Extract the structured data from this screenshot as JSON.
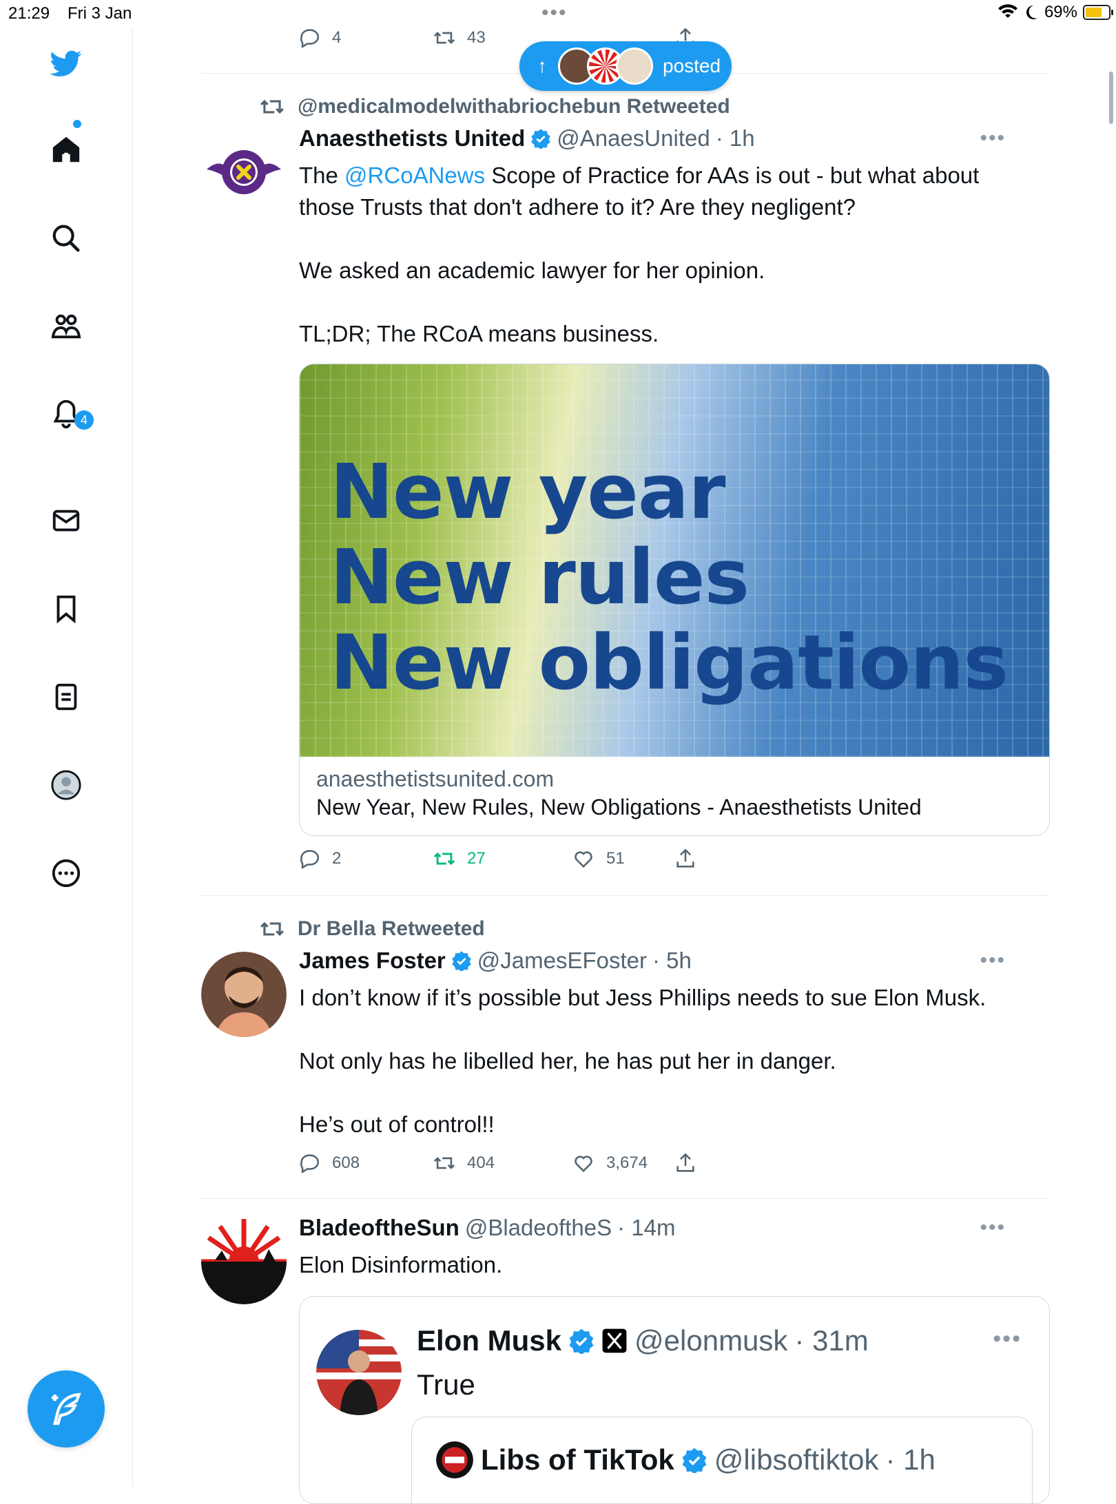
{
  "status_bar": {
    "time": "21:29",
    "date": "Fri 3 Jan",
    "battery": "69%"
  },
  "sidebar": {
    "notifications_badge": "4",
    "items": [
      "twitter-logo",
      "home",
      "search",
      "communities",
      "notifications",
      "messages",
      "bookmarks",
      "lists",
      "profile",
      "more"
    ]
  },
  "posted_pill": {
    "label": "posted"
  },
  "tweet_top_partial": {
    "replies": "4",
    "retweets": "43",
    "likes": "51"
  },
  "tweet1": {
    "retweeted_by": "@medicalmodelwithabriochebun Retweeted",
    "name": "Anaesthetists United",
    "handle": "@AnaesUnited",
    "time": "· 1h",
    "text_prefix": "The ",
    "mention": "@RCoANews",
    "text_rest": " Scope of Practice for AAs is out - but what about those Trusts that don't adhere to it? Are they negligent?\n\nWe asked an academic lawyer for her opinion.\n\nTL;DR; The RCoA means business.",
    "card": {
      "headline_1": "New year",
      "headline_2": "New rules",
      "headline_3": "New obligations",
      "domain": "anaesthetistsunited.com",
      "title": "New Year, New Rules, New Obligations - Anaesthetists United"
    },
    "replies": "2",
    "retweets": "27",
    "likes": "51"
  },
  "tweet2": {
    "retweeted_by": "Dr Bella Retweeted",
    "name": "James Foster",
    "handle": "@JamesEFoster",
    "time": "· 5h",
    "text": "I don’t know if it’s possible but Jess Phillips needs to sue Elon Musk.\n\nNot only has he libelled her, he has put her in danger.\n\nHe’s out of control!!",
    "replies": "608",
    "retweets": "404",
    "likes": "3,674"
  },
  "tweet3": {
    "name": "BladeoftheSun",
    "handle": "@BladeoftheS",
    "time": "· 14m",
    "text": "Elon Disinformation.",
    "quote": {
      "name": "Elon Musk",
      "handle": "@elonmusk",
      "time": "· 31m",
      "text": "True",
      "nested": {
        "name": "Libs of TikTok",
        "handle": "@libsoftiktok",
        "time": "· 1h"
      }
    }
  },
  "colors": {
    "accent": "#1d9bf0",
    "retweet_active": "#00ba7c",
    "muted": "#536471"
  }
}
